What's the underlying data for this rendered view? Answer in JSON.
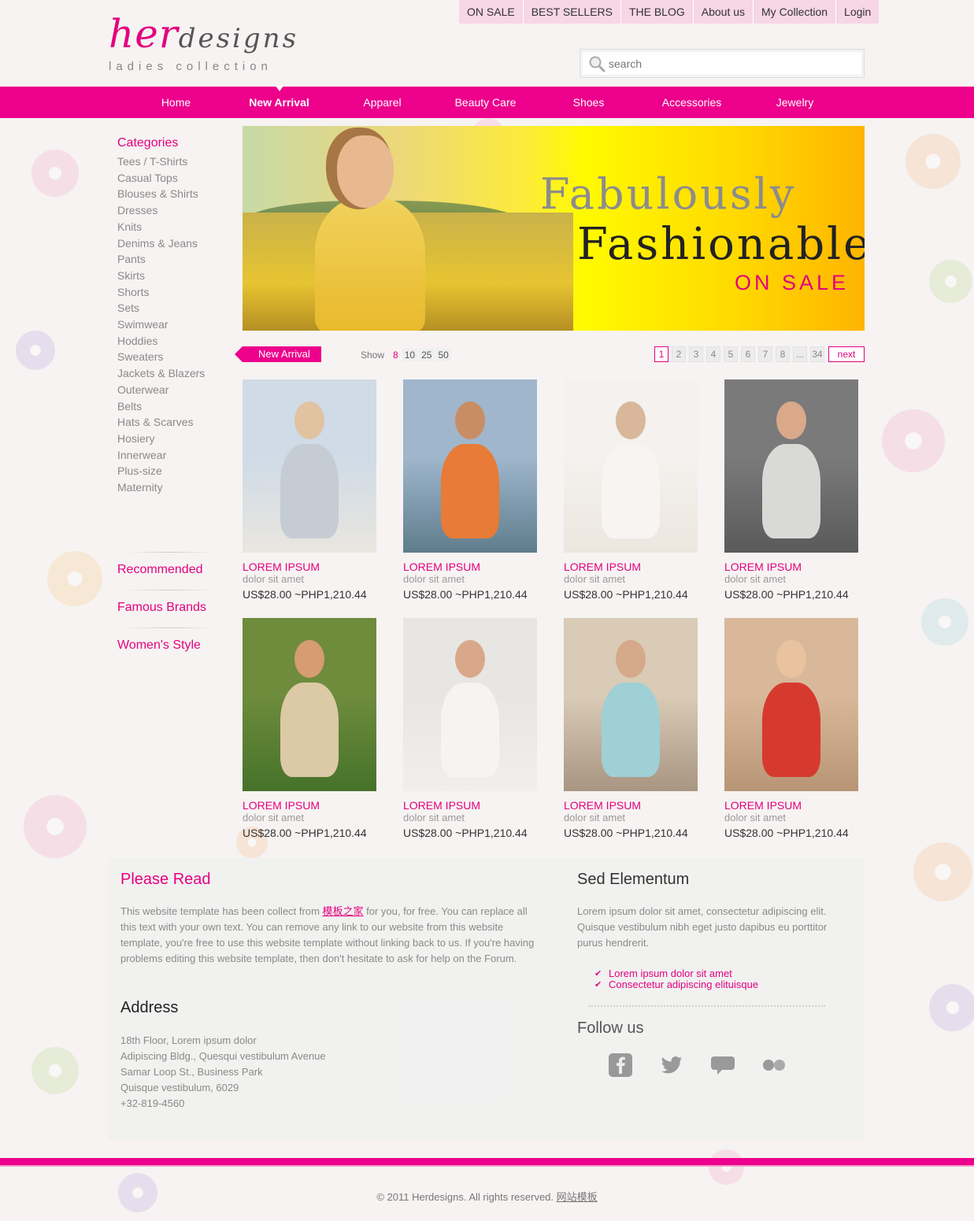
{
  "top_nav": [
    "ON SALE",
    "BEST SELLERS",
    "THE BLOG",
    "About us",
    "My Collection",
    "Login"
  ],
  "logo": {
    "her": "her",
    "designs": "designs",
    "tagline": "ladies collection"
  },
  "search": {
    "placeholder": "search"
  },
  "main_nav": [
    {
      "label": "Home",
      "active": false
    },
    {
      "label": "New Arrival",
      "active": true
    },
    {
      "label": "Apparel",
      "active": false
    },
    {
      "label": "Beauty Care",
      "active": false
    },
    {
      "label": "Shoes",
      "active": false
    },
    {
      "label": "Accessories",
      "active": false
    },
    {
      "label": "Jewelry",
      "active": false
    }
  ],
  "sidebar": {
    "categories_title": "Categories",
    "categories": [
      "Tees / T-Shirts",
      "Casual Tops",
      "Blouses & Shirts",
      "Dresses",
      "Knits",
      "Denims & Jeans",
      "Pants",
      "Skirts",
      "Shorts",
      "Sets",
      "Swimwear",
      "Hoddies",
      "Sweaters",
      "Jackets & Blazers",
      "Outerwear",
      "Belts",
      "Hats & Scarves",
      "Hosiery",
      "Innerwear",
      "Plus-size",
      "Maternity"
    ],
    "recommended": "Recommended",
    "famous_brands": "Famous Brands",
    "womens_style": "Women's Style"
  },
  "banner": {
    "line1": "Fabulously",
    "line2": "Fashionable",
    "line3": "ON SALE"
  },
  "listing": {
    "tag": "New Arrival",
    "show_label": "Show",
    "show_options": [
      "8",
      "10",
      "25",
      "50"
    ],
    "show_selected": "8",
    "pages": [
      "1",
      "2",
      "3",
      "4",
      "5",
      "6",
      "7",
      "8",
      "...",
      "34"
    ],
    "current_page": "1",
    "next_label": "next"
  },
  "products": [
    {
      "name": "LOREM IPSUM",
      "sub": "dolor sit amet",
      "price": "US$28.00 ~PHP1,210.44",
      "palette": [
        "#cfdbe6",
        "#e9e6df",
        "#c6ccd3",
        "#e1c3a2"
      ]
    },
    {
      "name": "LOREM IPSUM",
      "sub": "dolor sit amet",
      "price": "US$28.00 ~PHP1,210.44",
      "palette": [
        "#9fb6cc",
        "#5f7d8d",
        "#e77b37",
        "#c98d63"
      ]
    },
    {
      "name": "LOREM IPSUM",
      "sub": "dolor sit amet",
      "price": "US$28.00 ~PHP1,210.44",
      "palette": [
        "#f4f1ee",
        "#ece6df",
        "#f7f4f1",
        "#d8b79b"
      ]
    },
    {
      "name": "LOREM IPSUM",
      "sub": "dolor sit amet",
      "price": "US$28.00 ~PHP1,210.44",
      "palette": [
        "#7a7a7a",
        "#5a5a5a",
        "#d9d9d6",
        "#d9a98a"
      ]
    },
    {
      "name": "LOREM IPSUM",
      "sub": "dolor sit amet",
      "price": "US$28.00 ~PHP1,210.44",
      "palette": [
        "#6e8c3c",
        "#46722a",
        "#dcc9a6",
        "#d69c72"
      ]
    },
    {
      "name": "LOREM IPSUM",
      "sub": "dolor sit amet",
      "price": "US$28.00 ~PHP1,210.44",
      "palette": [
        "#e8e6e2",
        "#f0efeb",
        "#f5f4f0",
        "#d9a88b"
      ]
    },
    {
      "name": "LOREM IPSUM",
      "sub": "dolor sit amet",
      "price": "US$28.00 ~PHP1,210.44",
      "palette": [
        "#d9cbb6",
        "#a89582",
        "#9fd0d6",
        "#d5a98a"
      ]
    },
    {
      "name": "LOREM IPSUM",
      "sub": "dolor sit amet",
      "price": "US$28.00 ~PHP1,210.44",
      "palette": [
        "#d9b89a",
        "#b79575",
        "#d63a2f",
        "#e9c2a0"
      ]
    }
  ],
  "info": {
    "please_read_title": "Please Read",
    "please_read_before": "This website template has been collect from ",
    "please_read_link": "模板之家",
    "please_read_after": " for you, for free. You can replace all this text with your own text. You can remove any link to our website from this website template, you're free to use this website template without linking back to us. If you're having problems editing this website template, then don't hesitate to ask for help on the Forum.",
    "address_title": "Address",
    "address_lines": [
      "18th Floor, Lorem ipsum dolor",
      "Adipiscing Bldg., Quesqui vestibulum Avenue",
      "Samar Loop St., Business Park",
      "Quisque vestibulum, 6029",
      "+32-819-4560"
    ],
    "sed_title": "Sed Elementum",
    "sed_text": "Lorem ipsum dolor sit amet, consectetur adipiscing elit. Quisque vestibulum nibh eget justo dapibus eu porttitor purus hendrerit.",
    "checks": [
      "Lorem ipsum dolor sit amet",
      "Consectetur adipiscing elituisque"
    ],
    "follow_title": "Follow us",
    "social": [
      "facebook-icon",
      "twitter-icon",
      "chat-icon",
      "flickr-icon"
    ]
  },
  "footer": {
    "copyright": "© 2011 Herdesigns. All rights reserved.",
    "link": "网站模板"
  },
  "colors": {
    "accent": "#ec008c",
    "text_pink": "#e4007f"
  }
}
